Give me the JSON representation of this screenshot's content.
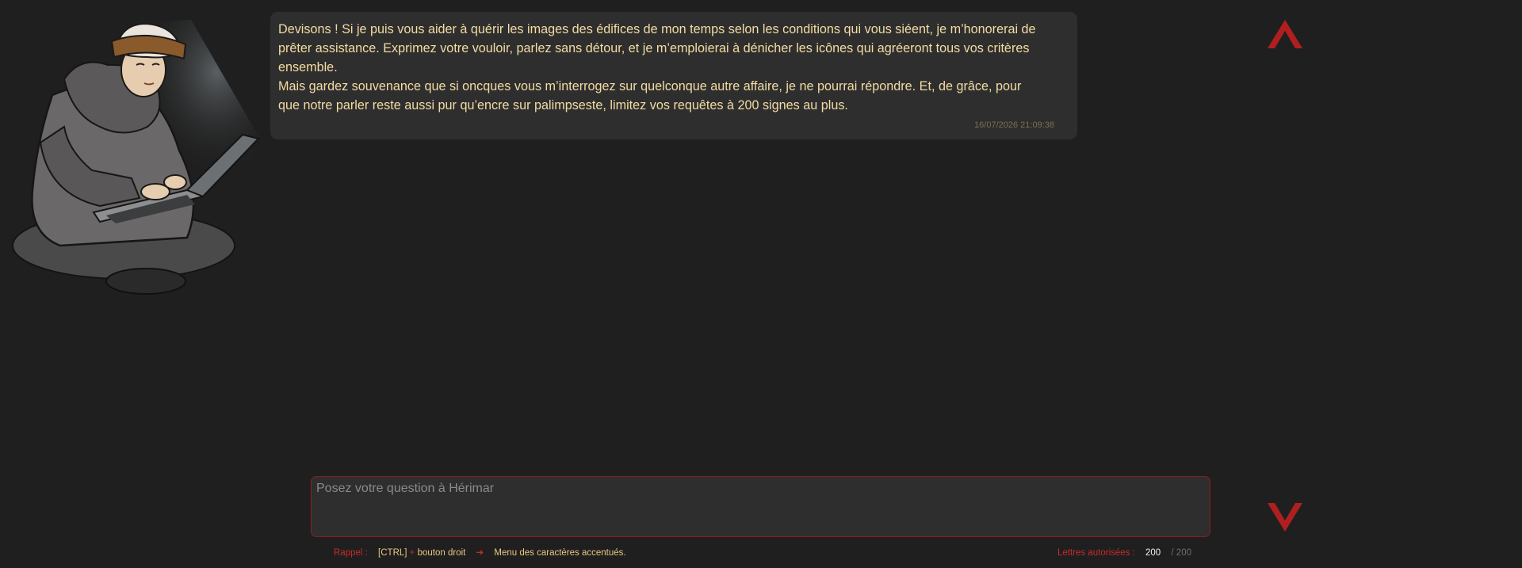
{
  "assistant": {
    "name": "Hérimar",
    "avatar_icon": "monk-with-laptop-illustration"
  },
  "messages": [
    {
      "lines": [
        "Devisons ! Si je puis vous aider à quérir les images des édifices de mon temps selon les conditions qui vous siéent, je m’honorerai de",
        "prêter assistance. Exprimez votre vouloir, parlez sans détour, et je m’emploierai à dénicher les icônes qui agréeront tous vos critères",
        "ensemble.",
        "Mais gardez souvenance que si oncques vous m’interrogez sur quelconque autre affaire, je ne pourrai répondre. Et, de grâce, pour",
        "que notre parler reste aussi pur qu’encre sur palimpseste, limitez vos requêtes à 200 signes au plus."
      ],
      "timestamp": "16/07/2026 21:09:38"
    }
  ],
  "input": {
    "placeholder": "Posez votre question à Hérimar",
    "value": ""
  },
  "footer": {
    "reminder_label": "Rappel :",
    "shortcut_key": "[CTRL]",
    "plus": "+",
    "shortcut_action": "bouton droit",
    "arrow_icon": "right-arrow-icon",
    "shortcut_result": "Menu des caractères accentués.",
    "letters_label": "Lettres autorisées :",
    "letters_remaining": "200",
    "letters_max": "/ 200"
  },
  "nav": {
    "scroll_up_icon": "chevron-up-icon",
    "scroll_down_icon": "chevron-down-icon"
  },
  "colors": {
    "background": "#1f1f1f",
    "bubble": "#2e2e2e",
    "message_text": "#f3dca3",
    "accent_red": "#b01f1f",
    "gold": "#e8c883"
  }
}
